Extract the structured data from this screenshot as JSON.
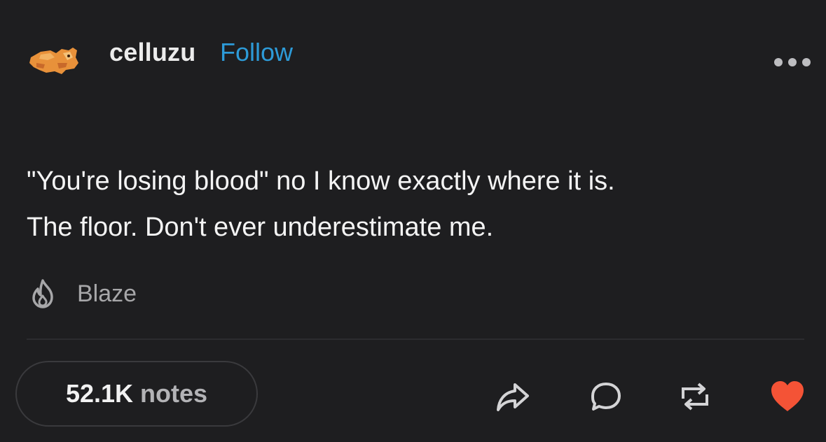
{
  "post": {
    "username": "celluzu",
    "follow_label": "Follow",
    "content_lines": [
      "\"You're losing blood\" no I know exactly where it is.",
      "The floor. Don't ever underestimate me."
    ],
    "blaze_label": "Blaze",
    "notes_count": "52.1K",
    "notes_label": "notes",
    "colors": {
      "background": "#1e1e20",
      "follow": "#2d9bd8",
      "like": "#f45336",
      "muted": "#a7a7a9"
    },
    "icons": [
      "avatar-image",
      "more-options-icon",
      "flame-icon",
      "share-icon",
      "reply-icon",
      "reblog-icon",
      "heart-icon"
    ],
    "liked": true
  }
}
